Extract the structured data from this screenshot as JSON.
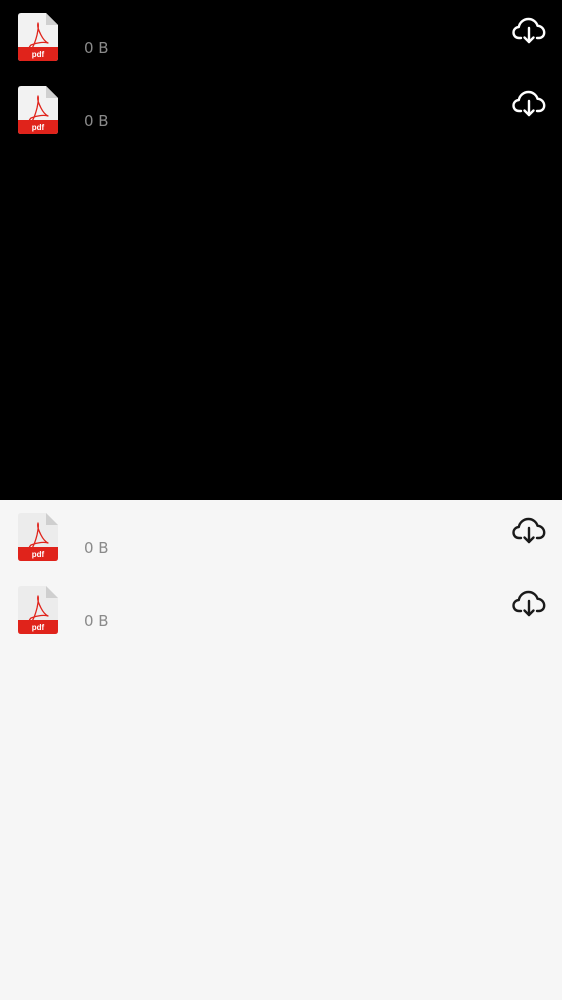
{
  "theme": {
    "dark_bg": "#000000",
    "light_bg": "#f6f6f6",
    "pdf_red": "#e0231b",
    "pdf_page": "#f2f2f2",
    "size_text": "#8a8a8a",
    "dark_icon": "#ffffff",
    "light_icon": "#1a1a1a"
  },
  "panels": [
    {
      "mode": "dark",
      "files": [
        {
          "type_label": "pdf",
          "size": "0 B",
          "action_icon": "cloud-download-icon"
        },
        {
          "type_label": "pdf",
          "size": "0 B",
          "action_icon": "cloud-download-icon"
        }
      ]
    },
    {
      "mode": "light",
      "files": [
        {
          "type_label": "pdf",
          "size": "0 B",
          "action_icon": "cloud-download-icon"
        },
        {
          "type_label": "pdf",
          "size": "0 B",
          "action_icon": "cloud-download-icon"
        }
      ]
    }
  ]
}
